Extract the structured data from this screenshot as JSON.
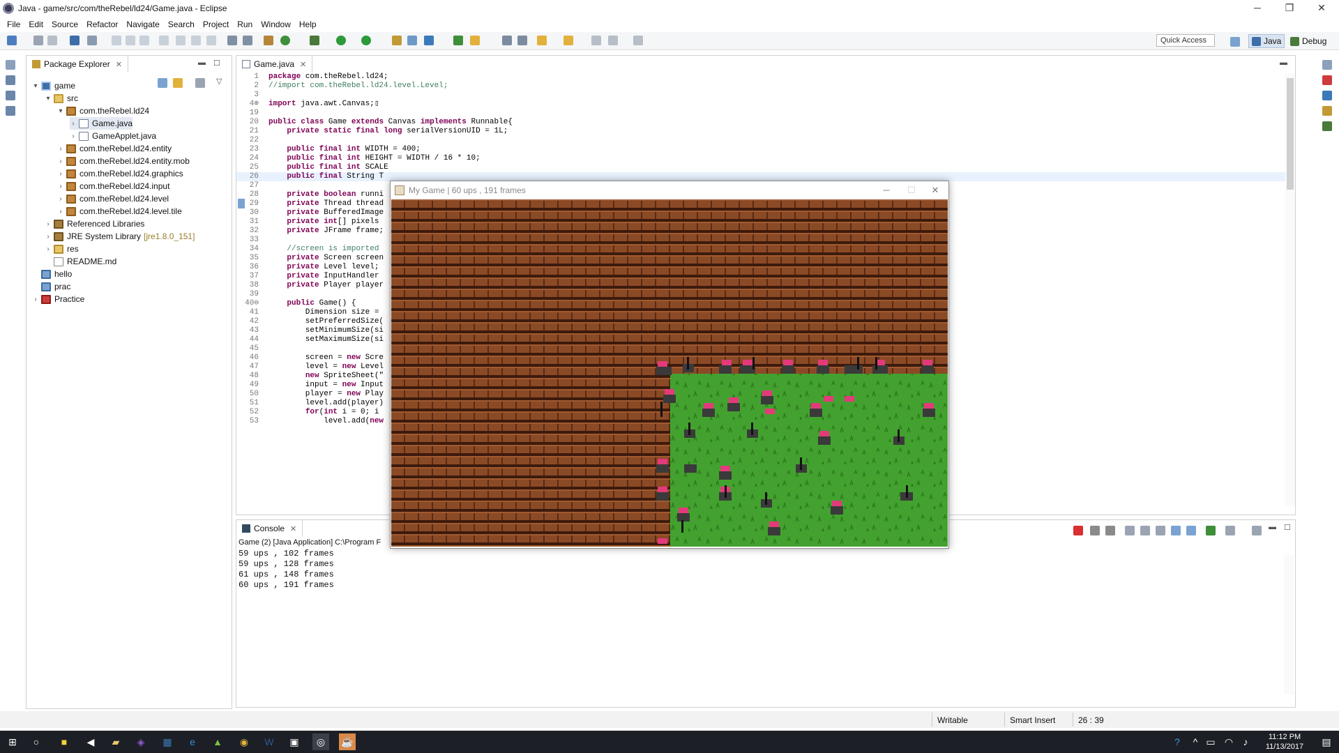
{
  "window": {
    "title": "Java - game/src/com/theRebel/ld24/Game.java - Eclipse",
    "minimize": "─",
    "restore": "❐",
    "close": "✕"
  },
  "menu": [
    "File",
    "Edit",
    "Source",
    "Refactor",
    "Navigate",
    "Search",
    "Project",
    "Run",
    "Window",
    "Help"
  ],
  "toolbar": {
    "quick_access": "Quick Access",
    "perspective_java": "Java",
    "perspective_debug": "Debug"
  },
  "package_explorer": {
    "tab_label": "Package Explorer",
    "items": [
      {
        "label": "game",
        "depth": 0,
        "twisty": "▾",
        "icon": "project-icon"
      },
      {
        "label": "src",
        "depth": 1,
        "twisty": "▾",
        "icon": "source-folder-icon"
      },
      {
        "label": "com.theRebel.ld24",
        "depth": 2,
        "twisty": "▾",
        "icon": "package-icon"
      },
      {
        "label": "Game.java",
        "depth": 3,
        "twisty": "›",
        "icon": "java-file-icon",
        "selected": true
      },
      {
        "label": "GameApplet.java",
        "depth": 3,
        "twisty": "›",
        "icon": "java-file-icon"
      },
      {
        "label": "com.theRebel.ld24.entity",
        "depth": 2,
        "twisty": "›",
        "icon": "package-icon"
      },
      {
        "label": "com.theRebel.ld24.entity.mob",
        "depth": 2,
        "twisty": "›",
        "icon": "package-icon"
      },
      {
        "label": "com.theRebel.ld24.graphics",
        "depth": 2,
        "twisty": "›",
        "icon": "package-icon"
      },
      {
        "label": "com.theRebel.ld24.input",
        "depth": 2,
        "twisty": "›",
        "icon": "package-icon"
      },
      {
        "label": "com.theRebel.ld24.level",
        "depth": 2,
        "twisty": "›",
        "icon": "package-icon"
      },
      {
        "label": "com.theRebel.ld24.level.tile",
        "depth": 2,
        "twisty": "›",
        "icon": "package-icon"
      },
      {
        "label": "Referenced Libraries",
        "depth": 1,
        "twisty": "›",
        "icon": "library-icon"
      },
      {
        "label": "JRE System Library",
        "suffix": "[jre1.8.0_151]",
        "depth": 1,
        "twisty": "›",
        "icon": "library-icon"
      },
      {
        "label": "res",
        "depth": 1,
        "twisty": "›",
        "icon": "folder-icon"
      },
      {
        "label": "README.md",
        "depth": 1,
        "twisty": "",
        "icon": "file-icon"
      },
      {
        "label": "hello",
        "depth": 0,
        "twisty": "",
        "icon": "closed-project-icon"
      },
      {
        "label": "prac",
        "depth": 0,
        "twisty": "",
        "icon": "closed-project-icon"
      },
      {
        "label": "Practice",
        "depth": 0,
        "twisty": "›",
        "icon": "error-project-icon"
      }
    ]
  },
  "editor": {
    "tab_label": "Game.java",
    "lines": [
      {
        "n": "1",
        "t": "package com.theRebel.ld24;"
      },
      {
        "n": "2",
        "t": "//import com.theRebel.ld24.level.Level;"
      },
      {
        "n": "3",
        "t": ""
      },
      {
        "n": "4⊕",
        "t": "import java.awt.Canvas;▯"
      },
      {
        "n": "19",
        "t": ""
      },
      {
        "n": "20",
        "t": "public class Game extends Canvas implements Runnable{"
      },
      {
        "n": "21",
        "t": "    private static final long serialVersionUID = 1L;"
      },
      {
        "n": "22",
        "t": ""
      },
      {
        "n": "23",
        "t": "    public final int WIDTH = 400;"
      },
      {
        "n": "24",
        "t": "    public final int HEIGHT = WIDTH / 16 * 10;"
      },
      {
        "n": "25",
        "t": "    public final int SCALE"
      },
      {
        "n": "26",
        "t": "    public final String T"
      },
      {
        "n": "27",
        "t": ""
      },
      {
        "n": "28",
        "t": "    private boolean runni"
      },
      {
        "n": "29",
        "t": "    private Thread thread"
      },
      {
        "n": "30",
        "t": "    private BufferedImage"
      },
      {
        "n": "31",
        "t": "    private int[] pixels"
      },
      {
        "n": "32",
        "t": "    private JFrame frame;"
      },
      {
        "n": "33",
        "t": ""
      },
      {
        "n": "34",
        "t": "    //screen is imported"
      },
      {
        "n": "35",
        "t": "    private Screen screen"
      },
      {
        "n": "36",
        "t": "    private Level level;"
      },
      {
        "n": "37",
        "t": "    private InputHandler"
      },
      {
        "n": "38",
        "t": "    private Player player"
      },
      {
        "n": "39",
        "t": ""
      },
      {
        "n": "40⊖",
        "t": "    public Game() {"
      },
      {
        "n": "41",
        "t": "        Dimension size ="
      },
      {
        "n": "42",
        "t": "        setPreferredSize("
      },
      {
        "n": "43",
        "t": "        setMinimumSize(si"
      },
      {
        "n": "44",
        "t": "        setMaximumSize(si"
      },
      {
        "n": "45",
        "t": ""
      },
      {
        "n": "46",
        "t": "        screen = new Scre"
      },
      {
        "n": "47",
        "t": "        level = new Level"
      },
      {
        "n": "48",
        "t": "        new SpriteSheet(\""
      },
      {
        "n": "49",
        "t": "        input = new Input"
      },
      {
        "n": "50",
        "t": "        player = new Play"
      },
      {
        "n": "51",
        "t": "        level.add(player)"
      },
      {
        "n": "52",
        "t": "        for(int i = 0; i"
      },
      {
        "n": "53",
        "t": "            level.add(new"
      }
    ]
  },
  "game_window": {
    "title": "My Game | 60 ups , 191 frames",
    "minimize": "─",
    "maximize": "☐",
    "close": "✕"
  },
  "console": {
    "tab_label": "Console",
    "header": "Game (2) [Java Application] C:\\Program F",
    "lines": [
      "59 ups , 102 frames",
      "59 ups , 128 frames",
      "61 ups , 148 frames",
      "60 ups , 191 frames"
    ]
  },
  "status": {
    "writable": "Writable",
    "insert": "Smart Insert",
    "position": "26 : 39"
  },
  "taskbar": {
    "time": "11:12 PM",
    "date": "11/13/2017"
  },
  "colors": {
    "brick": "#8b4a26",
    "mortar": "#3d1a0d",
    "grass": "#43a22f",
    "selection": "#d9e4f1"
  }
}
